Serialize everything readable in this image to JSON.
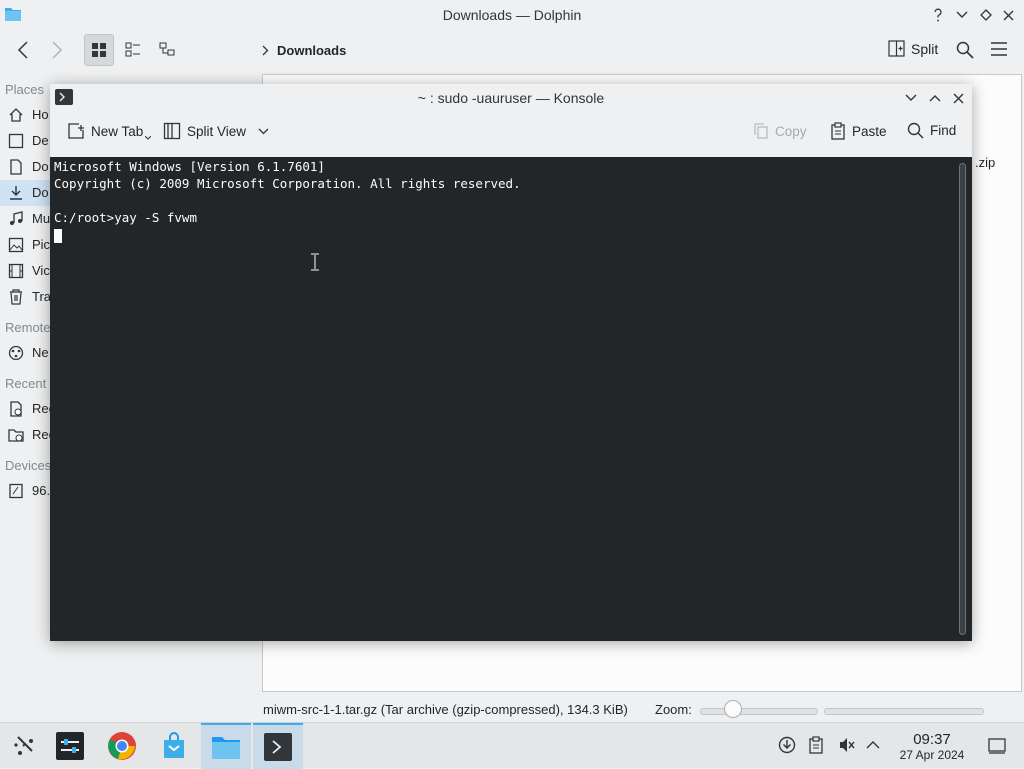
{
  "dolphin": {
    "title": "Downloads — Dolphin",
    "breadcrumb": "Downloads",
    "split_label": "Split",
    "places_header": "Places",
    "places": [
      {
        "label": "Ho",
        "icon": "home-icon"
      },
      {
        "label": "De",
        "icon": "desktop-icon"
      },
      {
        "label": "Do",
        "icon": "documents-icon"
      },
      {
        "label": "Do",
        "icon": "downloads-icon",
        "selected": true
      },
      {
        "label": "Mu",
        "icon": "music-icon"
      },
      {
        "label": "Pic",
        "icon": "pictures-icon"
      },
      {
        "label": "Vic",
        "icon": "videos-icon"
      },
      {
        "label": "Tra",
        "icon": "trash-icon"
      }
    ],
    "remote_header": "Remote",
    "remote": [
      {
        "label": "Ne",
        "icon": "network-icon"
      }
    ],
    "recent_header": "Recent",
    "recent": [
      {
        "label": "Rec",
        "icon": "recent-files-icon"
      },
      {
        "label": "Rec",
        "icon": "recent-locations-icon"
      }
    ],
    "devices_header": "Devices",
    "devices": [
      {
        "label": "96.",
        "icon": "drive-icon"
      }
    ],
    "visible_file_label": ".zip",
    "status_text": "miwm-src-1-1.tar.gz (Tar archive (gzip-compressed), 134.3 KiB)",
    "zoom_label": "Zoom:"
  },
  "konsole": {
    "title": "~ : sudo -uauruser — Konsole",
    "toolbar": {
      "new_tab": "New Tab",
      "split_view": "Split View",
      "copy": "Copy",
      "paste": "Paste",
      "find": "Find"
    },
    "terminal_lines": "Microsoft Windows [Version 6.1.7601]\nCopyright (c) 2009 Microsoft Corporation. All rights reserved.\n\nC:/root>yay -S fvwm"
  },
  "taskbar": {
    "apps": [
      "app-launcher-icon",
      "system-settings-icon",
      "chrome-icon",
      "discover-store-icon",
      "dolphin-files-icon",
      "konsole-icon"
    ],
    "clock_time": "09:37",
    "clock_date": "27 Apr 2024"
  },
  "colors": {
    "accent": "#3daee9",
    "terminal_bg": "#232629",
    "window_bg": "#eff0f1"
  }
}
